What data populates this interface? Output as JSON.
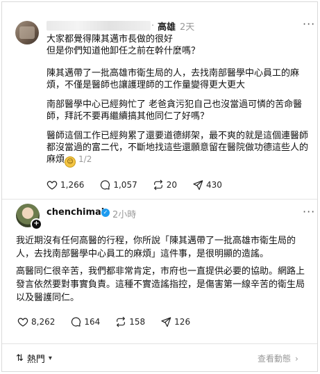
{
  "post": {
    "location": "高雄",
    "time": "2天",
    "paragraphs": [
      "大家都覺得陳其邁市長做的很好\n但是你們知道他卸任之前在幹什麼嗎？",
      "陳其邁帶了一批高雄市衛生局的人，去找南部醫學中心員工的麻煩，不僅是醫師也讓護理師的工作量變得更大更大",
      "南部醫學中心已經夠忙了 老爸貪污犯自己也沒當過可憐的苦命醫師，拜託不要再繼續搞其他同仁了好嗎？",
      "醫師這個工作已經夠累了還要道德綁架，最不爽的就是這個連醫師都沒當過的富二代，不斷地找這些還願意留在醫院做功德這些人的麻煩"
    ],
    "page_indicator": "1/2",
    "likes": "1,266",
    "comments": "1,057",
    "reposts": "20",
    "shares": "430"
  },
  "reply": {
    "username": "chenchimai",
    "time": "2小時",
    "paragraphs": [
      "我近期沒有任何高醫的行程，你所說「陳其邁帶了一批高雄市衛生局的人，去找南部醫學中心員工的麻煩」這件事，是很明顯的造謠。",
      "高醫同仁很辛苦，我們都非常肯定，市府也一直提供必要的協助。網路上發言依然要對事實負責。這種不實造謠指控，是傷害第一線辛苦的衛生局以及醫護同仁。"
    ],
    "likes": "8,262",
    "comments": "164",
    "reposts": "158",
    "shares": "126"
  },
  "footer": {
    "sort_label": "熱門",
    "activity_label": "查看動態"
  },
  "icons": [
    "heart-icon",
    "comment-icon",
    "repost-icon",
    "share-icon",
    "more-icon",
    "verified-icon",
    "sort-icon",
    "chevron-right-icon"
  ],
  "colors": {
    "verified": "#1d9bf0",
    "muted": "#999999",
    "divider": "#e3e3e3"
  }
}
